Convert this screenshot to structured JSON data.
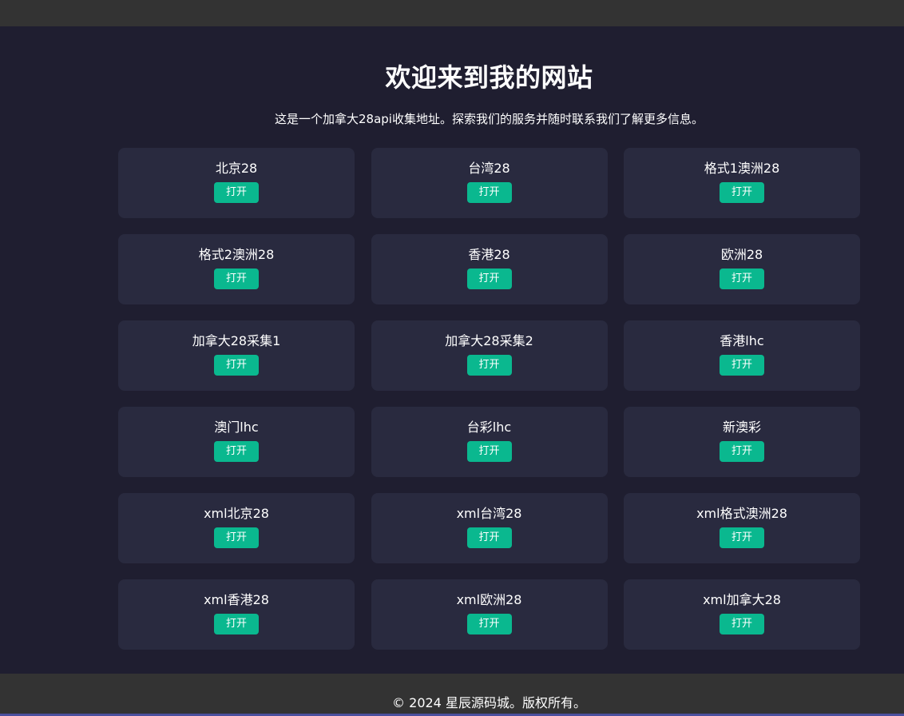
{
  "page": {
    "title": "欢迎来到我的网站",
    "subtitle": "这是一个加拿大28api收集地址。探索我们的服务并随时联系我们了解更多信息。"
  },
  "cards": [
    {
      "title": "北京28",
      "button": "打开"
    },
    {
      "title": "台湾28",
      "button": "打开"
    },
    {
      "title": "格式1澳洲28",
      "button": "打开"
    },
    {
      "title": "格式2澳洲28",
      "button": "打开"
    },
    {
      "title": "香港28",
      "button": "打开"
    },
    {
      "title": "欧洲28",
      "button": "打开"
    },
    {
      "title": "加拿大28采集1",
      "button": "打开"
    },
    {
      "title": "加拿大28采集2",
      "button": "打开"
    },
    {
      "title": "香港lhc",
      "button": "打开"
    },
    {
      "title": "澳门lhc",
      "button": "打开"
    },
    {
      "title": "台彩lhc",
      "button": "打开"
    },
    {
      "title": "新澳彩",
      "button": "打开"
    },
    {
      "title": "xml北京28",
      "button": "打开"
    },
    {
      "title": "xml台湾28",
      "button": "打开"
    },
    {
      "title": "xml格式澳洲28",
      "button": "打开"
    },
    {
      "title": "xml香港28",
      "button": "打开"
    },
    {
      "title": "xml欧洲28",
      "button": "打开"
    },
    {
      "title": "xml加拿大28",
      "button": "打开"
    }
  ],
  "footer": {
    "text": "© 2024 星辰源码城。版权所有。"
  },
  "colors": {
    "background": "#1f1e30",
    "card": "#292a3f",
    "accent": "#0ab88f",
    "bars": "#333333"
  }
}
